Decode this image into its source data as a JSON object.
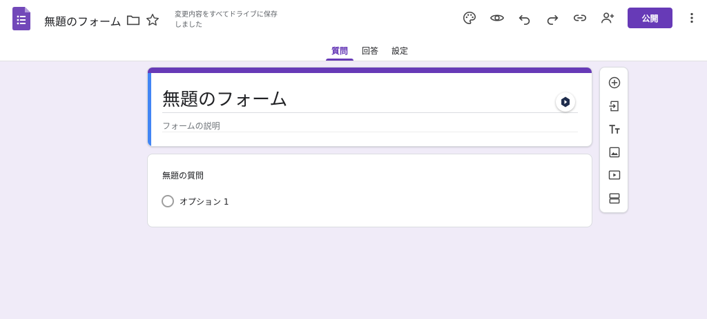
{
  "header": {
    "doc_title": "無題のフォーム",
    "save_status": "変更内容をすべてドライブに保存しました",
    "publish_label": "公開"
  },
  "tabs": [
    {
      "label": "質問",
      "active": true
    },
    {
      "label": "回答",
      "active": false
    },
    {
      "label": "設定",
      "active": false
    }
  ],
  "form": {
    "title": "無題のフォーム",
    "description_placeholder": "フォームの説明"
  },
  "question": {
    "title": "無題の質問",
    "options": [
      "オプション 1"
    ]
  },
  "side_toolbar": [
    "add-question-icon",
    "import-questions-icon",
    "add-title-icon",
    "add-image-icon",
    "add-video-icon",
    "add-section-icon"
  ],
  "colors": {
    "accent": "#673ab7",
    "background": "#f0ebf8",
    "left_strip": "#4285f4"
  }
}
